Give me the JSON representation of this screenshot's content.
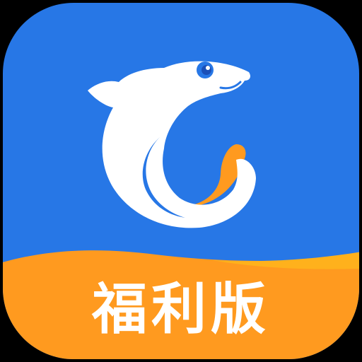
{
  "app_icon": {
    "badge_text": "福利版",
    "logo": "dolphin-logo",
    "colors": {
      "background": "#2777E6",
      "banner": "#FF9A1F",
      "banner_highlight": "#FFB11C",
      "dolphin": "#FFFFFF",
      "eye": "#2777E6",
      "canvas": "#000000"
    }
  }
}
